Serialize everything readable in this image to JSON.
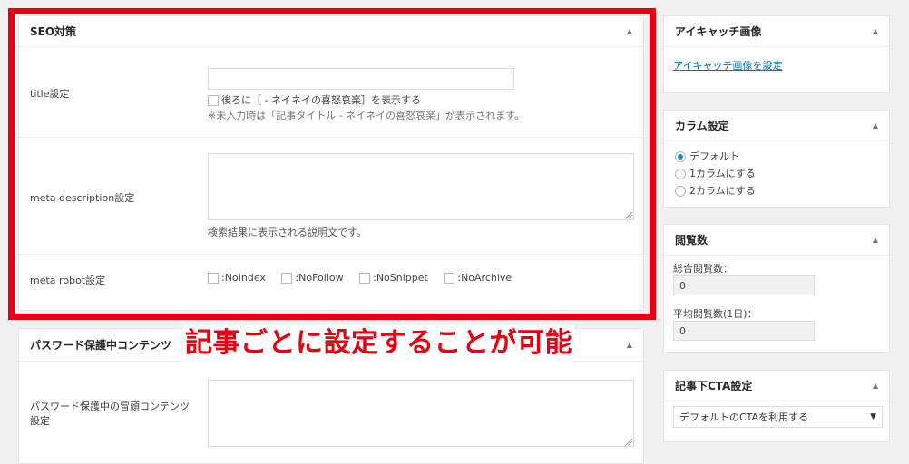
{
  "seo_box": {
    "title": "SEO対策",
    "title_label": "title設定",
    "title_value": "",
    "suffix_checkbox_label": "後ろに［ - ネイネイの喜怒哀楽］を表示する",
    "title_note": "※未入力時は「記事タイトル - ネイネイの喜怒哀楽」が表示されます。",
    "desc_label": "meta description設定",
    "desc_value": "",
    "desc_note": "検索結果に表示される説明文です。",
    "robot_label": "meta robot設定",
    "robots": [
      ":NoIndex",
      ":NoFollow",
      ":NoSnippet",
      ":NoArchive"
    ]
  },
  "password_box": {
    "title": "パスワード保護中コンテンツ",
    "field_label_line1": "パスワード保護中の冒頭コンテンツ",
    "field_label_line2": "設定",
    "field_value": ""
  },
  "annotation": {
    "callout": "記事ごとに設定することが可能",
    "frame_color": "#e60012"
  },
  "eyecatch_box": {
    "title": "アイキャッチ画像",
    "link": "アイキャッチ画像を設定"
  },
  "column_box": {
    "title": "カラム設定",
    "options": [
      "デフォルト",
      "1カラムにする",
      "2カラムにする"
    ],
    "selected_index": 0
  },
  "views_box": {
    "title": "閲覧数",
    "total_label": "総合閲覧数：",
    "total_value": "0",
    "avg_label": "平均閲覧数(1日)：",
    "avg_value": "0"
  },
  "cta_box": {
    "title": "記事下CTA設定",
    "select_value": "デフォルトのCTAを利用する"
  },
  "colors": {
    "link": "#0073aa",
    "accent": "#e60012",
    "radio_dot": "#1e8cbe"
  }
}
